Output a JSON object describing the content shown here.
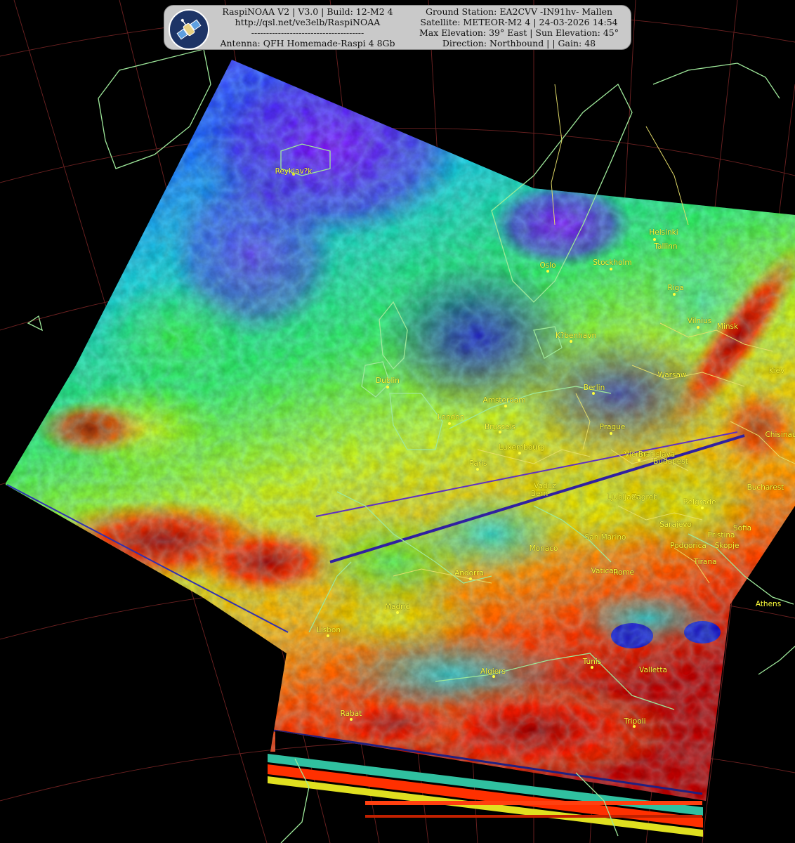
{
  "header": {
    "left_lines": [
      "RaspiNOAA V2 | V3.0 | Build: 12-M2 4",
      "http://qsl.net/ve3elb/RaspiNOAA",
      "--------------------------------------",
      "Antenna: QFH Homemade-Raspi 4 8Gb"
    ],
    "right_lines": [
      "Ground Station: EA2CVV -IN91hv- Mallen",
      "Satellite: METEOR-M2 4 | 24-03-2026 14:54",
      "Max Elevation: 39° East | Sun Elevation: 45°",
      "Direction: Northbound | | Gain: 48"
    ],
    "logo_icon": "satellite-icon"
  },
  "colors": {
    "background": "#000000",
    "grid": "#8a2a2a",
    "coastline": "#9ee89a",
    "border": "#e8e06a",
    "city_label": "#ffff3c"
  },
  "cities": [
    {
      "name": "Reykjav?k"
    },
    {
      "name": "Helsinki"
    },
    {
      "name": "Tallinn"
    },
    {
      "name": "Oslo"
    },
    {
      "name": "Stockholm"
    },
    {
      "name": "Riga"
    },
    {
      "name": "Vilnius"
    },
    {
      "name": "Minsk"
    },
    {
      "name": "K?benhavn"
    },
    {
      "name": "Dublin"
    },
    {
      "name": "Kiev"
    },
    {
      "name": "Warsaw"
    },
    {
      "name": "Berlin"
    },
    {
      "name": "Amsterdam"
    },
    {
      "name": "London"
    },
    {
      "name": "Brussels"
    },
    {
      "name": "Prague"
    },
    {
      "name": "Chisinau"
    },
    {
      "name": "Luxembourg"
    },
    {
      "name": "Vienna"
    },
    {
      "name": "Bratislava"
    },
    {
      "name": "Budapest"
    },
    {
      "name": "Paris"
    },
    {
      "name": "Vaduz"
    },
    {
      "name": "Bern"
    },
    {
      "name": "Bucharest"
    },
    {
      "name": "Ljubljana"
    },
    {
      "name": "Zagreb"
    },
    {
      "name": "Belgrade"
    },
    {
      "name": "Sarajevo"
    },
    {
      "name": "Sofia"
    },
    {
      "name": "Monaco"
    },
    {
      "name": "San Marino"
    },
    {
      "name": "Podgorica"
    },
    {
      "name": "Pristina"
    },
    {
      "name": "Skopje"
    },
    {
      "name": "Andorra"
    },
    {
      "name": "Vatican"
    },
    {
      "name": "Rome"
    },
    {
      "name": "Tirana"
    },
    {
      "name": "Madrid"
    },
    {
      "name": "Athens"
    },
    {
      "name": "Lisbon"
    },
    {
      "name": "Tunis"
    },
    {
      "name": "Algiers"
    },
    {
      "name": "Valletta"
    },
    {
      "name": "Rabat"
    },
    {
      "name": "Tripoli"
    }
  ]
}
